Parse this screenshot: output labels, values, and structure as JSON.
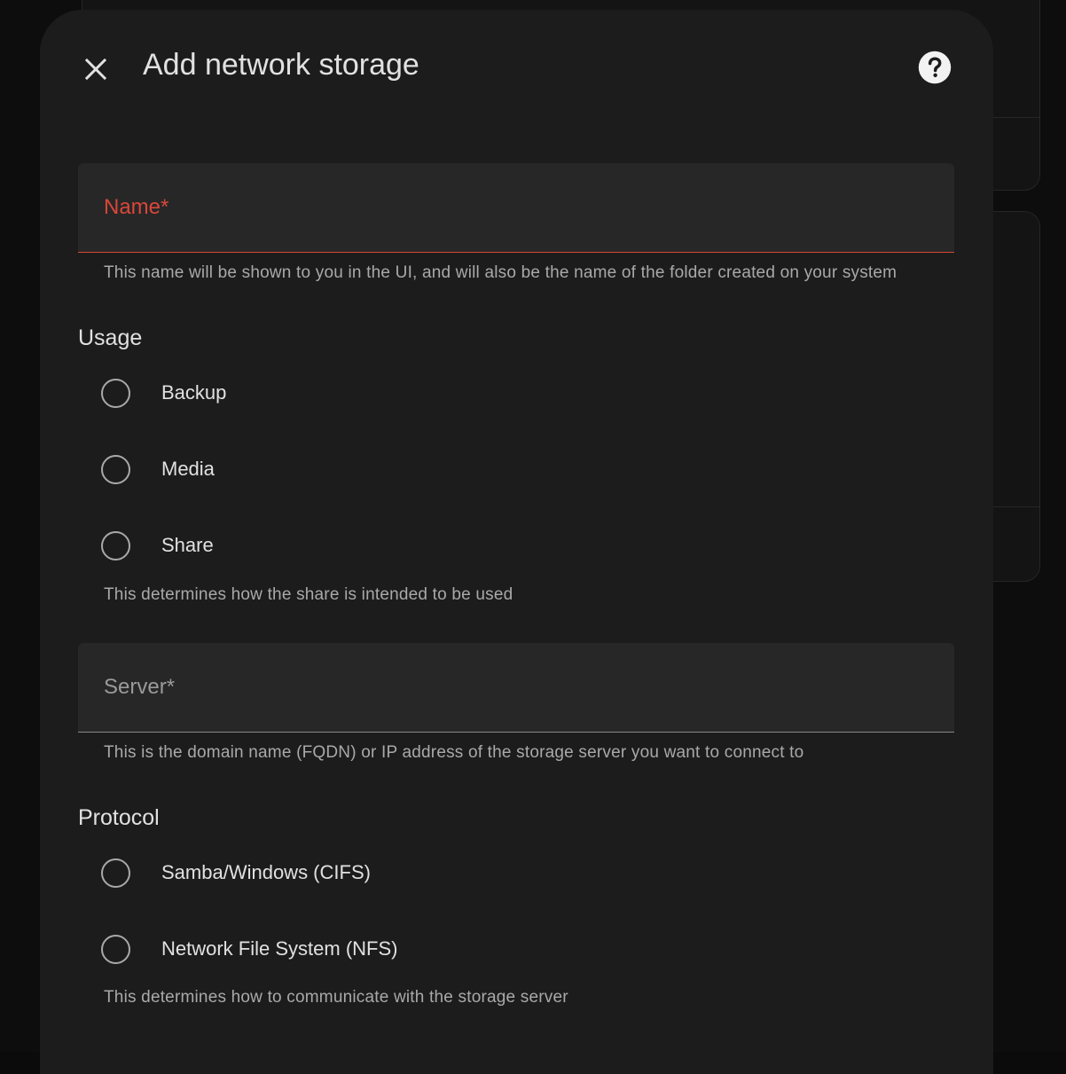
{
  "dialog": {
    "title": "Add network storage",
    "close_icon": "close-icon",
    "help_icon": "help-circle-icon"
  },
  "form": {
    "name": {
      "label": "Name*",
      "helper": "This name will be shown to you in the UI, and will also be the name of the folder created on your system"
    },
    "usage": {
      "title": "Usage",
      "options": [
        {
          "label": "Backup"
        },
        {
          "label": "Media"
        },
        {
          "label": "Share"
        }
      ],
      "helper": "This determines how the share is intended to be used"
    },
    "server": {
      "label": "Server*",
      "helper": "This is the domain name (FQDN) or IP address of the storage server you want to connect to"
    },
    "protocol": {
      "title": "Protocol",
      "options": [
        {
          "label": "Samba/Windows (CIFS)"
        },
        {
          "label": "Network File System (NFS)"
        }
      ],
      "helper": "This determines how to communicate with the storage server"
    }
  },
  "colors": {
    "error": "#d9473a",
    "surface": "#1c1c1c",
    "field": "#272727"
  }
}
